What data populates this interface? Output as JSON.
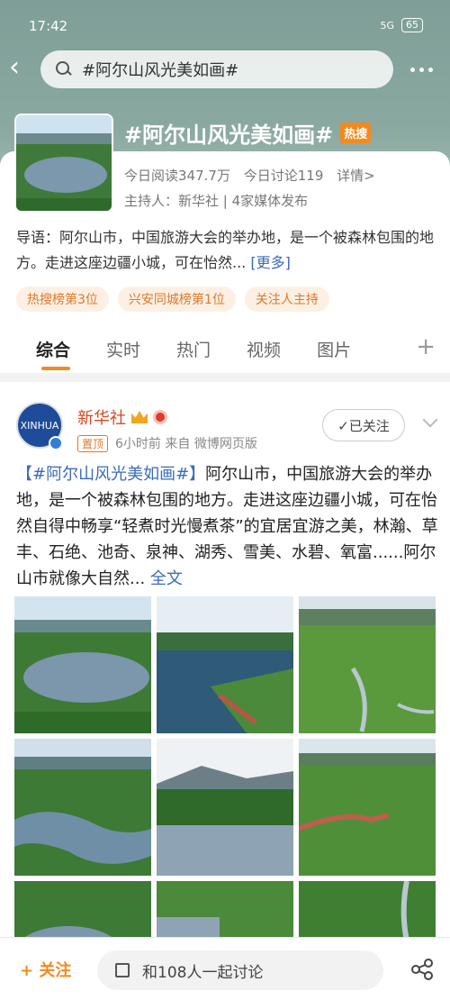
{
  "status_bar": {
    "time": "17:42",
    "network": "5G",
    "battery": "65"
  },
  "search": {
    "query": "#阿尔山风光美如画#"
  },
  "topic": {
    "title": "#阿尔山风光美如画#",
    "hot_badge": "热搜",
    "reads": "今日阅读347.7万",
    "discussions": "今日讨论119",
    "details": "详情>",
    "host": "主持人：新华社 | 4家媒体发布",
    "intro": "导语：阿尔山市，中国旅游大会的举办地，是一个被森林包围的地方。走进这座边疆小城，可在怡然...",
    "intro_more": "[更多]",
    "tags": [
      "热搜榜第3位",
      "兴安同城榜第1位",
      "关注人主持"
    ]
  },
  "tabs": [
    "综合",
    "实时",
    "热门",
    "视频",
    "图片"
  ],
  "post": {
    "author": "新华社",
    "avatar_text": "XINHUA",
    "pin": "置顶",
    "meta": "6小时前  来自 微博网页版",
    "follow_label": "✓已关注",
    "hashtag": "【#阿尔山风光美如画#】",
    "text": "阿尔山市，中国旅游大会的举办地，是一个被森林包围的地方。走进这座边疆小城，可在怡然自得中畅享“轻煮时光慢煮茶”的宜居宜游之美，林瀚、草丰、石绝、池奇、泉神、湖秀、雪美、水碧、氧富......阿尔山市就像大自然...",
    "full_link": "全文"
  },
  "bottom_bar": {
    "follow": "+ 关注",
    "discuss": "和108人一起讨论"
  },
  "colors": {
    "accent": "#f28a1e",
    "link": "#3a6bb8",
    "author": "#d34a20"
  }
}
